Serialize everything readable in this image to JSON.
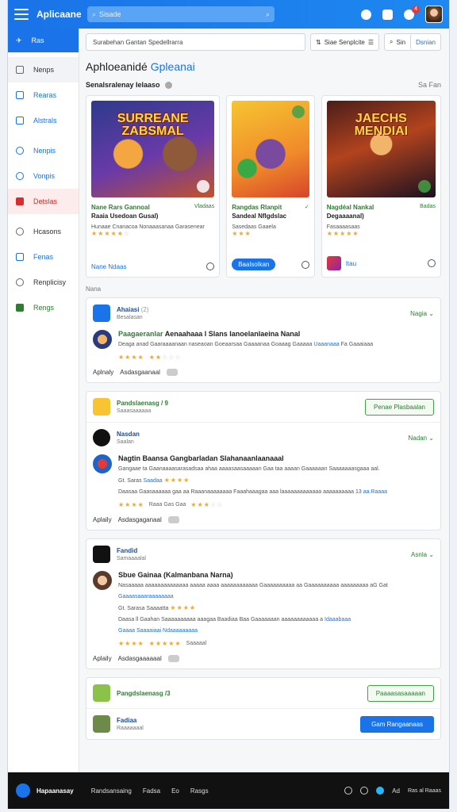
{
  "topbar": {
    "brand": "Aplicaane",
    "search_placeholder": "Sisade",
    "badge": "4"
  },
  "sidebar": {
    "home": "Ras",
    "items": [
      {
        "label": "Nenps",
        "color": ""
      },
      {
        "label": "Rearas",
        "color": "blue"
      },
      {
        "label": "Alstrals",
        "color": "blue"
      },
      {
        "label": "Nenpis",
        "color": "blue"
      },
      {
        "label": "Vonpis",
        "color": "blue"
      },
      {
        "label": "Detslas",
        "color": "red"
      },
      {
        "label": "Hcasons",
        "color": ""
      },
      {
        "label": "Fenas",
        "color": "blue"
      },
      {
        "label": "Renplicisy",
        "color": ""
      },
      {
        "label": "Rengs",
        "color": "green"
      }
    ]
  },
  "toolbar": {
    "filter_value": "Surabehan Gantan Spedellrarra",
    "sort_label": "Siae Senplcite",
    "search_label": "Sin",
    "apply_label": "Dsnian"
  },
  "page": {
    "title_main": "Aphloeanidé",
    "title_accent": "Gpleanai",
    "section_title": "Senalsralenay Ielaaso",
    "section_right": "Sa Fan"
  },
  "featured": [
    {
      "logo": "SURREANE ZABSMAL",
      "name": "Nane Rars Gannoal",
      "tag": "Vladaas",
      "subtitle": "Raaia Usedoan Gusal)",
      "desc": "Hunaae Cnanacoa Nonaaasanaa Garasenear",
      "stars": 5,
      "footer": "Nane Ndaas"
    },
    {
      "logo": "",
      "name": "Rangdas Rlanpit",
      "tag": "",
      "subtitle": "Sandeal Nflgdslac",
      "desc": "Sasedaas Gaaela",
      "stars": 3,
      "footer": "Baalsolkan"
    },
    {
      "logo": "JAECHS MENDIAI",
      "name": "Nagdéal Nankal",
      "tag": "Badas",
      "subtitle": "Degaaaanal)",
      "desc": "Fasaaaasaas",
      "stars": 5,
      "footer": "Itau"
    }
  ],
  "list_label": "Nana",
  "cards": [
    {
      "type": "post",
      "app_name": "Ahaiasi",
      "app_meta": "Besalasan",
      "app_count": "(2)",
      "status": "Nagia",
      "game_title_a": "Paagaeranlar",
      "game_title_b": "Aenaahaaa l Slans Ianoelanlaeina Nanal",
      "game_desc_a": "Deaga anad Gaaraaaanaan naseaoan Goeaarsaa Gaaaanaa Goaaag Gaaaaa",
      "game_desc_hl": "Uaaanaaa",
      "game_desc_b": "Fa Gaaaiaaa",
      "actions": [
        "Aplnaly",
        "Asdasgaanaal"
      ]
    },
    {
      "type": "group",
      "group_name": "Pandslaenasg / 9",
      "group_meta": "Saaasaaaaaa",
      "group_button": "Penae Plasbaalan",
      "app_name": "Nasdan",
      "app_meta": "Saalan",
      "status": "Nadan",
      "game_title_a": "Nagtin Baansa Gangbarladan",
      "game_title_b": "Slahanaanlaanaaal",
      "game_desc_a": "Gangaae ta Gaanaaaasarasadsaa ahaa aaaasaasaaaaan Gaa taa aaaan Gaaaaaan Saaaaaaasgaaa aal.",
      "game_meta_line": "Gt. Saras",
      "game_meta_hl": "Saadaa",
      "game_desc_c": "Daasaa Gaasaaaaaa gaa aa Raaanaaaaaaaa Faaahaaagaa aaa laaaaaaaaaaaaa aaaaaaaaaa 13",
      "game_desc_hl": "aa.Raaaa",
      "game_rating_note": "Raaa Gas Gaa",
      "actions": [
        "Aplaily",
        "Asdasgaganaal"
      ]
    },
    {
      "type": "post",
      "app_name": "Fandid",
      "app_meta": "Samaaaalal",
      "status": "Asnla",
      "game_title_a": "Sbue Gainaa",
      "game_title_b": "(Kalmanbana Narna)",
      "game_desc_a": "Nasaaaaa aaaaaaaaaaaaaa aaaaa aaaa aaaaaaaaaaaa Gaaaaaaaaaa aa Gaaaaaaaaaa aaaaaaaaa aG Gat",
      "game_meta_hl": "Gaaaasaaaraaaaaaaa",
      "game_meta_line": "Gt. Sarasa Saaaatta",
      "game_desc_c": "Daasa ll Gaahan Saaaaaaaaaa aaagaa Baadiaa Baa Gaaaaaaan aaaaaaaaaaaa a",
      "game_desc_hl": "Idaaabaaa",
      "game_desc_d": "Gaaaa Saaaaiaai Ndaaaaaaaaa",
      "game_rating_note": "Saaaaal",
      "actions": [
        "Aplaily",
        "Asdasgaaaaaal"
      ]
    },
    {
      "type": "group",
      "group_name": "Pangdslaenasg /3",
      "group_meta": "",
      "group_button": "Paaaasasaaaaan",
      "app_name": "Fadiaa",
      "app_meta": "Raaaaaaal",
      "status": "",
      "solid_button": "Gam Rangaanaas"
    }
  ],
  "bottombar": {
    "brand": "Hapaanasay",
    "links": [
      "Randsansaing",
      "Fadsa",
      "Eo",
      "Rasgs"
    ],
    "version_a": "Ad",
    "version_b": "Ras al Raaas"
  },
  "colors": {
    "primary": "#1a73e8",
    "success": "#2e7d32",
    "danger": "#d32f2f",
    "star": "#f5a623"
  }
}
